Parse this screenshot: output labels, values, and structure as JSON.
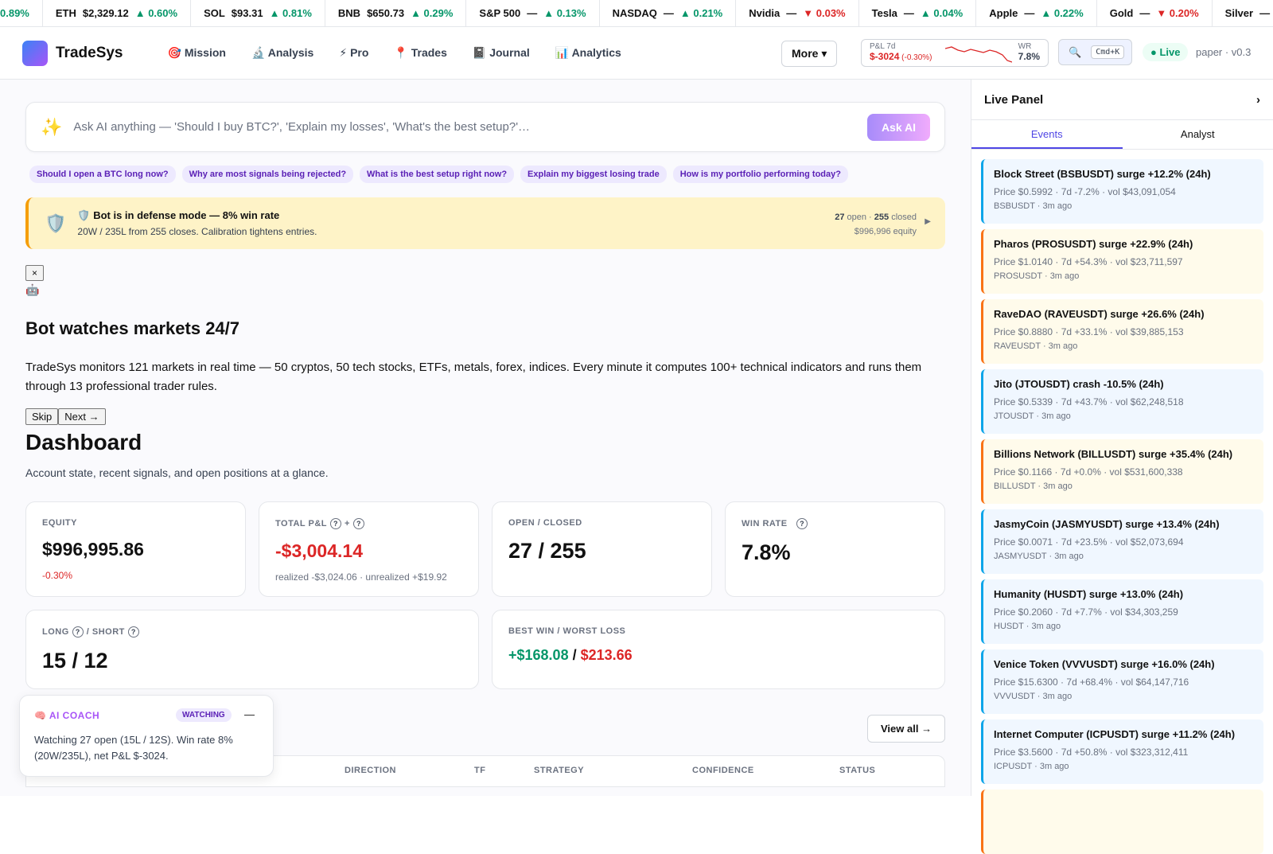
{
  "ticker": [
    {
      "name": "",
      "price": "",
      "change": "0.89%",
      "dir": "up"
    },
    {
      "name": "ETH",
      "price": "$2,329.12",
      "change": "▲ 0.60%",
      "dir": "up"
    },
    {
      "name": "SOL",
      "price": "$93.31",
      "change": "▲ 0.81%",
      "dir": "up"
    },
    {
      "name": "BNB",
      "price": "$650.73",
      "change": "▲ 0.29%",
      "dir": "up"
    },
    {
      "name": "S&P 500",
      "price": "—",
      "change": "▲ 0.13%",
      "dir": "up"
    },
    {
      "name": "NASDAQ",
      "price": "—",
      "change": "▲ 0.21%",
      "dir": "up"
    },
    {
      "name": "Nvidia",
      "price": "—",
      "change": "▼ 0.03%",
      "dir": "dn"
    },
    {
      "name": "Tesla",
      "price": "—",
      "change": "▲ 0.04%",
      "dir": "up"
    },
    {
      "name": "Apple",
      "price": "—",
      "change": "▲ 0.22%",
      "dir": "up"
    },
    {
      "name": "Gold",
      "price": "—",
      "change": "▼ 0.20%",
      "dir": "dn"
    },
    {
      "name": "Silver",
      "price": "—",
      "change": "▼ 0.44%",
      "dir": "dn"
    }
  ],
  "header": {
    "brand": "TradeSys",
    "nav": [
      "🎯 Mission",
      "🔬 Analysis",
      "⚡ Pro",
      "📍 Trades",
      "📓 Journal",
      "📊 Analytics"
    ],
    "more": "More ▾",
    "pnl_label": "P&L 7d",
    "pnl_value": "$-3024",
    "pnl_pct": "(-0.30%)",
    "wr_label": "WR",
    "wr_value": "7.8%",
    "search_icon": "🔍",
    "search_kbd": "Cmd+K",
    "live": "● Live",
    "version": "paper · v0.3"
  },
  "ask": {
    "icon": "✨",
    "placeholder": "Ask AI anything — 'Should I buy BTC?', 'Explain my losses', 'What's the best setup?'…",
    "button": "Ask AI"
  },
  "chips": [
    "Should I open a BTC long now?",
    "Why are most signals being rejected?",
    "What is the best setup right now?",
    "Explain my biggest losing trade",
    "How is my portfolio performing today?"
  ],
  "defense": {
    "icon": "🛡️",
    "title": "🛡️ Bot is in defense mode — 8% win rate",
    "sub": "20W / 235L from 255 closes. Calibration tightens entries.",
    "open": "27",
    "open_label": " open · ",
    "closed": "255",
    "closed_label": " closed",
    "equity": "$996,996 equity",
    "arrow": "▶"
  },
  "onboard": {
    "close": "×",
    "icon": "🤖",
    "title": "Bot watches markets 24/7",
    "body": "TradeSys monitors 121 markets in real time — 50 cryptos, 50 tech stocks, ETFs, metals, forex, indices. Every minute it computes 100+ technical indicators and runs them through 13 professional trader rules.",
    "skip": "Skip",
    "next": "Next →"
  },
  "dashboard": {
    "title": "Dashboard",
    "subtitle": "Account state, recent signals, and open positions at a glance."
  },
  "cards": {
    "equity": {
      "label": "EQUITY",
      "value": "$996,995.86",
      "sub": "-0.30%"
    },
    "pnl": {
      "label": "TOTAL P&L",
      "q1": "?",
      "plus": "+",
      "q2": "?",
      "value": "-$3,004.14",
      "sub": "realized -$3,024.06 · unrealized +$19.92"
    },
    "openclosed": {
      "label": "OPEN / CLOSED",
      "value": "27 / 255"
    },
    "winrate": {
      "label": "WIN RATE",
      "q": "?",
      "value": "7.8%"
    },
    "longshort": {
      "label1": "LONG",
      "q1": "?",
      "label2": "/ SHORT",
      "q2": "?",
      "value": "15 / 12"
    },
    "bestworst": {
      "label": "BEST WIN / WORST LOSS",
      "best": "+$168.08",
      "sep": " / ",
      "worst": "$213.66"
    }
  },
  "coach": {
    "title": "🧠 AI COACH",
    "badge": "WATCHING",
    "min": "—",
    "body": "Watching 27 open (15L / 12S). Win rate 8% (20W/235L), net P&L $-3024."
  },
  "table": {
    "view_all": "View all →",
    "columns": [
      "DIRECTION",
      "TF",
      "STRATEGY",
      "CONFIDENCE",
      "STATUS"
    ]
  },
  "panel": {
    "title": "Live Panel",
    "chevron": "›",
    "tabs": [
      "Events",
      "Analyst"
    ],
    "events": [
      {
        "title": "Block Street (BSBUSDT) surge +12.2% (24h)",
        "detail": "Price $0.5992 · 7d -7.2% · vol $43,091,054",
        "sub": "BSBUSDT · 3m ago",
        "color": "blue"
      },
      {
        "title": "Pharos (PROSUSDT) surge +22.9% (24h)",
        "detail": "Price $1.0140 · 7d +54.3% · vol $23,711,597",
        "sub": "PROSUSDT · 3m ago",
        "color": "orange"
      },
      {
        "title": "RaveDAO (RAVEUSDT) surge +26.6% (24h)",
        "detail": "Price $0.8880 · 7d +33.1% · vol $39,885,153",
        "sub": "RAVEUSDT · 3m ago",
        "color": "orange"
      },
      {
        "title": "Jito (JTOUSDT) crash -10.5% (24h)",
        "detail": "Price $0.5339 · 7d +43.7% · vol $62,248,518",
        "sub": "JTOUSDT · 3m ago",
        "color": "blue"
      },
      {
        "title": "Billions Network (BILLUSDT) surge +35.4% (24h)",
        "detail": "Price $0.1166 · 7d +0.0% · vol $531,600,338",
        "sub": "BILLUSDT · 3m ago",
        "color": "orange"
      },
      {
        "title": "JasmyCoin (JASMYUSDT) surge +13.4% (24h)",
        "detail": "Price $0.0071 · 7d +23.5% · vol $52,073,694",
        "sub": "JASMYUSDT · 3m ago",
        "color": "blue"
      },
      {
        "title": "Humanity (HUSDT) surge +13.0% (24h)",
        "detail": "Price $0.2060 · 7d +7.7% · vol $34,303,259",
        "sub": "HUSDT · 3m ago",
        "color": "blue"
      },
      {
        "title": "Venice Token (VVVUSDT) surge +16.0% (24h)",
        "detail": "Price $15.6300 · 7d +68.4% · vol $64,147,716",
        "sub": "VVVUSDT · 3m ago",
        "color": "blue"
      },
      {
        "title": "Internet Computer (ICPUSDT) surge +11.2% (24h)",
        "detail": "Price $3.5600 · 7d +50.8% · vol $323,312,411",
        "sub": "ICPUSDT · 3m ago",
        "color": "blue"
      },
      {
        "title": "",
        "detail": "",
        "sub": "",
        "color": "orange"
      }
    ]
  }
}
